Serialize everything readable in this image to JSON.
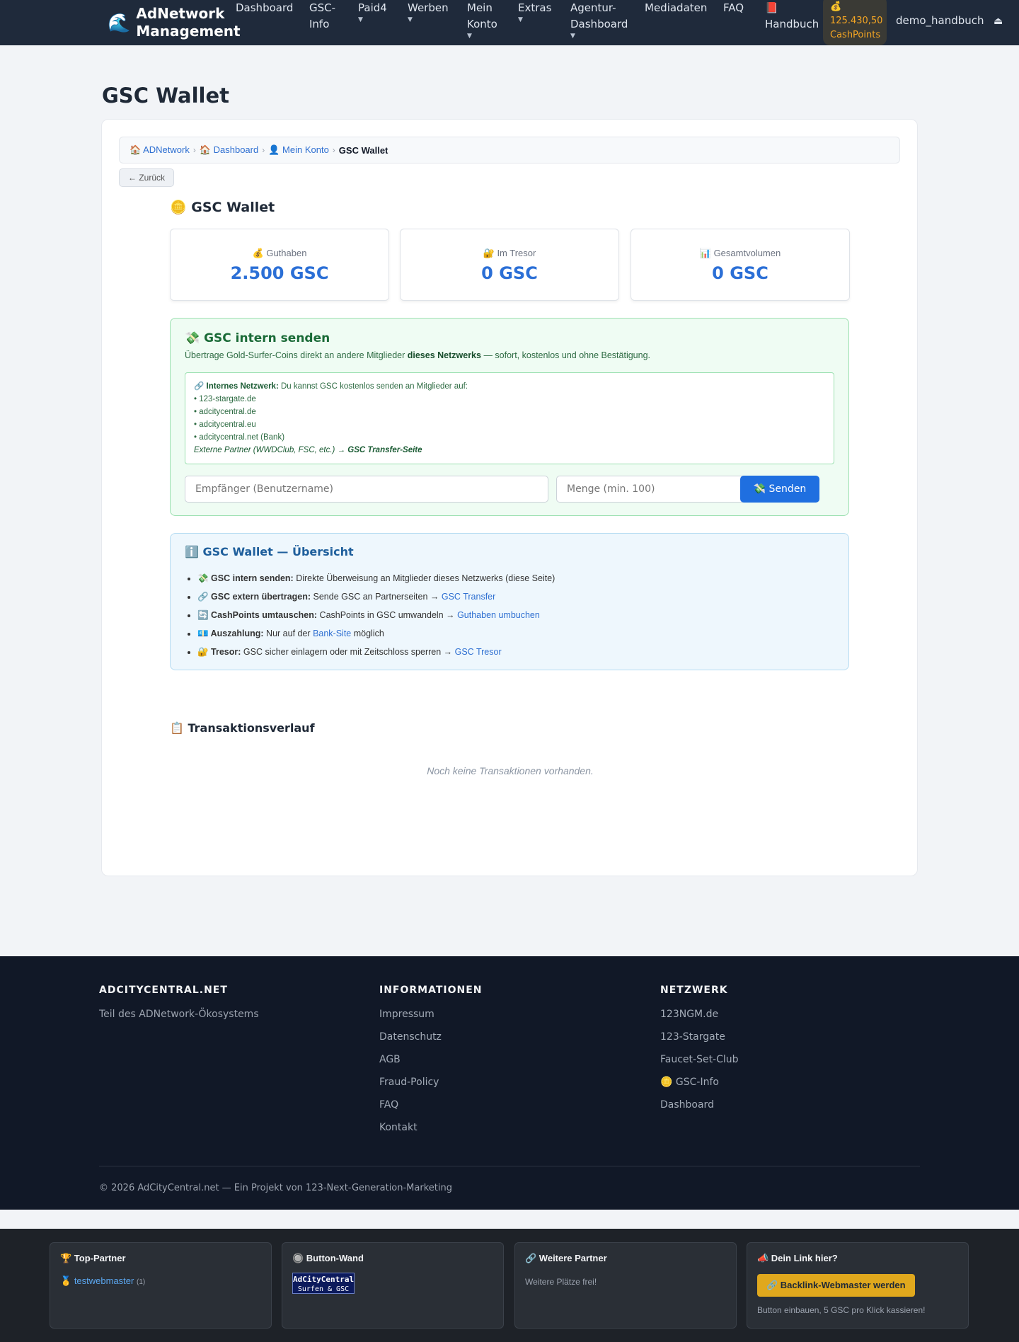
{
  "nav": {
    "brand": "AdNetwork Management",
    "brand_icon": "wave-icon",
    "items": [
      {
        "label": "Dashboard",
        "caret": ""
      },
      {
        "label": "GSC-Info",
        "caret": ""
      },
      {
        "label": "Paid4",
        "caret": "▼"
      },
      {
        "label": "Werben",
        "caret": "▼"
      },
      {
        "label": "Mein Konto",
        "caret": "▼"
      },
      {
        "label": "Extras",
        "caret": "▼"
      },
      {
        "label": "Agentur-Dashboard",
        "caret": "▼"
      },
      {
        "label": "Mediadaten",
        "caret": ""
      },
      {
        "label": "FAQ",
        "caret": ""
      },
      {
        "label": "Handbuch",
        "caret": ""
      }
    ],
    "cashpoints_icon": "💰",
    "cashpoints_value": "125.430,50",
    "cashpoints_unit": "CashPoints",
    "username": "demo_handbuch",
    "logout_icon": "⏏"
  },
  "page": {
    "title": "GSC Wallet"
  },
  "breadcrumb": {
    "items": [
      "🏠 ADNetwork",
      "🏠 Dashboard",
      "👤 Mein Konto"
    ],
    "current": "GSC Wallet",
    "separator": "›"
  },
  "back_button": "← Zurück",
  "wallet": {
    "title": "🪙 GSC Wallet",
    "stats": [
      {
        "label": "💰 Guthaben",
        "value": "2.500 GSC"
      },
      {
        "label": "🔐 Im Tresor",
        "value": "0 GSC"
      },
      {
        "label": "📊 Gesamtvolumen",
        "value": "0 GSC"
      }
    ]
  },
  "send": {
    "title": "💸 GSC intern senden",
    "desc_pre": "Übertrage Gold-Surfer-Coins direkt an andere Mitglieder ",
    "desc_bold": "dieses Netzwerks",
    "desc_post": " — sofort, kostenlos und ohne Bestätigung.",
    "net_label": "🔗 Internes Netzwerk:",
    "net_text": " Du kannst GSC kostenlos senden an Mitglieder auf:",
    "sites": [
      "• 123-stargate.de",
      "• adcitycentral.de",
      "• adcitycentral.eu",
      "• adcitycentral.net (Bank)"
    ],
    "external_pre": "Externe Partner (WWDClub, FSC, etc.) → ",
    "external_link": "GSC Transfer-Seite",
    "recipient_placeholder": "Empfänger (Benutzername)",
    "amount_placeholder": "Menge (min. 100)",
    "send_button": "💸 Senden"
  },
  "overview": {
    "title": "ℹ️ GSC Wallet — Übersicht",
    "items": [
      {
        "bold": "💸 GSC intern senden:",
        "text": " Direkte Überweisung an Mitglieder dieses Netzwerks (diese Seite)",
        "link": "",
        "after": ""
      },
      {
        "bold": "🔗 GSC extern übertragen:",
        "text": " Sende GSC an Partnerseiten → ",
        "link": "GSC Transfer",
        "after": ""
      },
      {
        "bold": "🔄 CashPoints umtauschen:",
        "text": " CashPoints in GSC umwandeln → ",
        "link": "Guthaben umbuchen",
        "after": ""
      },
      {
        "bold": "💶 Auszahlung:",
        "text": " Nur auf der ",
        "link": "Bank-Site",
        "after": " möglich"
      },
      {
        "bold": "🔐 Tresor:",
        "text": " GSC sicher einlagern oder mit Zeitschloss sperren → ",
        "link": "GSC Tresor",
        "after": ""
      }
    ]
  },
  "transactions": {
    "title": "📋 Transaktionsverlauf",
    "empty": "Noch keine Transaktionen vorhanden."
  },
  "footer": {
    "col1": {
      "title": "ADCITYCENTRAL.NET",
      "text": "Teil des ADNetwork-Ökosystems"
    },
    "col2": {
      "title": "INFORMATIONEN",
      "links": [
        "Impressum",
        "Datenschutz",
        "AGB",
        "Fraud-Policy",
        "FAQ",
        "Kontakt"
      ]
    },
    "col3": {
      "title": "NETZWERK",
      "links": [
        "123NGM.de",
        "123-Stargate",
        "Faucet-Set-Club",
        "🪙 GSC-Info",
        "Dashboard"
      ]
    },
    "copyright": "© 2026 AdCityCentral.net — Ein Projekt von 123-Next-Generation-Marketing"
  },
  "partners": {
    "top": {
      "title": "🏆 Top-Partner",
      "name": "testwebmaster",
      "medal": "🥇",
      "count": "(1)"
    },
    "wall": {
      "title": "🔘 Button-Wand",
      "badge_line1": "AdCityCentral",
      "badge_line2": "Surfen & GSC"
    },
    "more": {
      "title": "🔗 Weitere Partner",
      "text": "Weitere Plätze frei!"
    },
    "your_link": {
      "title": "📣 Dein Link hier?",
      "button": "🔗 Backlink-Webmaster werden",
      "note": "Button einbauen, 5 GSC pro Klick kassieren!"
    }
  }
}
